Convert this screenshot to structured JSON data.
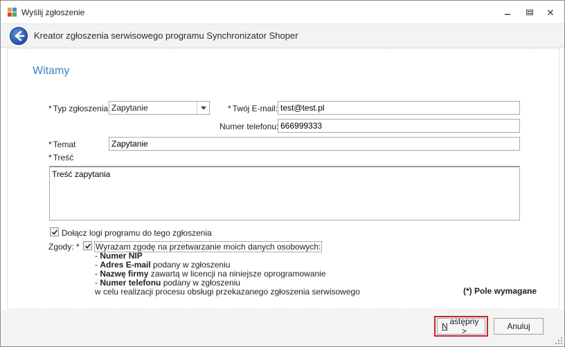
{
  "window": {
    "title": "Wyślij zgłoszenie"
  },
  "header": {
    "title": "Kreator zgłoszenia serwisowego programu Synchronizator Shoper"
  },
  "page": {
    "heading": "Witamy"
  },
  "form": {
    "required_marker": "*",
    "type": {
      "label": "Typ zgłoszenia",
      "selected": "Zapytanie"
    },
    "email": {
      "label": "Twój E-mail:",
      "value": "test@test.pl"
    },
    "phone": {
      "label": "Numer telefonu:",
      "value": "666999333"
    },
    "subject": {
      "label": "Temat",
      "value": "Zapytanie"
    },
    "body": {
      "label": "Treść",
      "value": "Treść zapytania"
    },
    "attach_logs": {
      "label": "Dołącz logi programu do tego zgłoszenia",
      "checked": true
    },
    "consents": {
      "label": "Zgody:",
      "consent_text": "Wyrażam zgodę na przetwarzanie moich danych osobowych:",
      "checked": true,
      "items": [
        {
          "prefix": "- ",
          "bold": "Numer NIP",
          "rest": ""
        },
        {
          "prefix": "- ",
          "bold": "Adres E-mail",
          "rest": " podany w zgłoszeniu"
        },
        {
          "prefix": "- ",
          "bold": "Nazwę firmy",
          "rest": " zawartą w licencji na niniejsze oprogramowanie"
        },
        {
          "prefix": "- ",
          "bold": "Numer telefonu",
          "rest": " podany w zgłoszeniu"
        }
      ],
      "purpose": "w celu realizacji procesu obsługi przekazanego zgłoszenia serwisowego"
    },
    "required_note": "(*) Pole wymagane"
  },
  "footer": {
    "next_label_first": "N",
    "next_label_rest": "astępny >",
    "cancel_label": "Anuluj"
  },
  "colors": {
    "accent_blue": "#3b7fc0",
    "highlight_red": "#c8232c"
  }
}
